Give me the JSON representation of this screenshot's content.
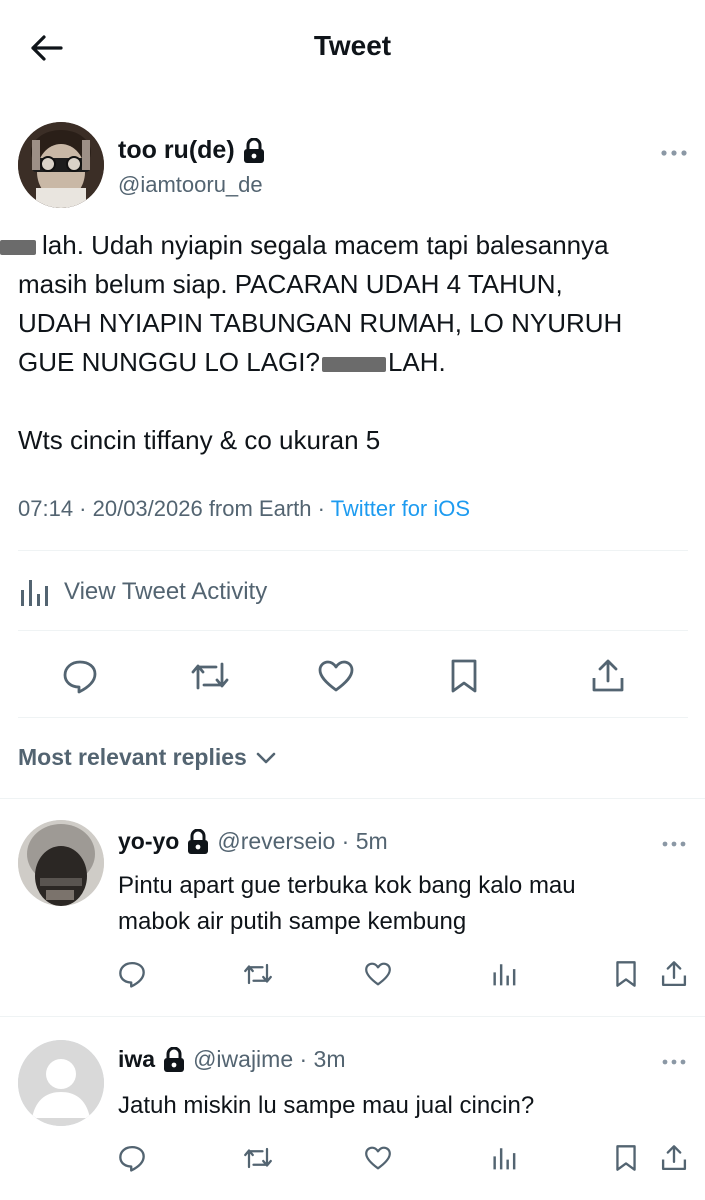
{
  "header": {
    "title": "Tweet"
  },
  "tweet": {
    "author_name": "too ru(de)",
    "author_handle": "@iamtooru_de",
    "line1": "lah. Udah nyiapin segala macem tapi balesannya",
    "line2": "masih belum siap. PACARAN UDAH 4 TAHUN,",
    "line3": "UDAH NYIAPIN TABUNGAN RUMAH, LO NYURUH",
    "line4_a": "GUE NUNGGU LO LAGI?",
    "line4_b": "LAH.",
    "line5": "Wts cincin tiffany & co ukuran 5",
    "timestamp": "07:14 · 20/03/2026 from Earth · ",
    "client": "Twitter for iOS",
    "view_activity": "View Tweet Activity"
  },
  "replies_sort": {
    "label": "Most relevant replies"
  },
  "replies": [
    {
      "name": "yo-yo",
      "handle": "@reverseio · 5m",
      "text1": "Pintu apart gue terbuka kok bang kalo mau",
      "text2": "mabok air putih sampe kembung"
    },
    {
      "name": "iwa",
      "handle": "@iwajime · 3m",
      "text1": "Jatuh miskin lu sampe mau jual cincin?",
      "text2": ""
    }
  ],
  "icons": {
    "back": "arrow-left-icon",
    "lock": "lock-icon",
    "more": "more-horizontal-icon",
    "analytics": "bar-chart-icon",
    "reply": "reply-icon",
    "retweet": "retweet-icon",
    "like": "heart-icon",
    "bookmark": "bookmark-icon",
    "share": "share-icon",
    "chevron": "chevron-down-icon"
  },
  "colors": {
    "text": "#0f1419",
    "secondary": "#536471",
    "link": "#1d9bf0",
    "divider": "#eff3f4"
  }
}
